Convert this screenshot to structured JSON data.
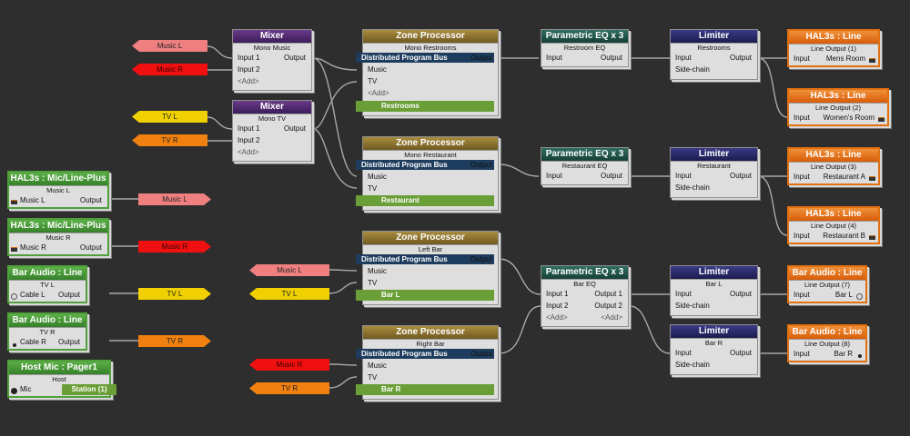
{
  "colors": {
    "canvas": "#2e2e2e",
    "mixer": "#4a2a6a",
    "zone_processor": "#8a733a",
    "parametric_eq": "#1f5247",
    "limiter": "#2a2a6a",
    "output": "#e8701c",
    "input_block": "#4f9f3b",
    "program_bus": "#1e3d5e",
    "zone_bar": "#6a9e36",
    "music_l": "#f08080",
    "music_r": "#f01010",
    "tv_l": "#f0d000",
    "tv_r": "#f08010"
  },
  "mixers": [
    {
      "title": "Mixer",
      "name": "Mono Music",
      "in1": "Input 1",
      "in2": "Input 2",
      "add": "<Add>",
      "out": "Output"
    },
    {
      "title": "Mixer",
      "name": "Mono TV",
      "in1": "Input 1",
      "in2": "Input 2",
      "add": "<Add>",
      "out": "Output"
    }
  ],
  "zones": [
    {
      "title": "Zone Processor",
      "name": "Mono Restrooms",
      "bus": "Distributed Program Bus",
      "music": "Music",
      "tv": "TV",
      "add": "<Add>",
      "zone": "Restrooms",
      "out": "Output"
    },
    {
      "title": "Zone Processor",
      "name": "Mono Restaurant",
      "bus": "Distributed Program Bus",
      "music": "Music",
      "tv": "TV",
      "zone": "Restaurant",
      "out": "Output"
    },
    {
      "title": "Zone Processor",
      "name": "Left Bar",
      "bus": "Distributed Program Bus",
      "music": "Music",
      "tv": "TV",
      "zone": "Bar L",
      "out": "Output"
    },
    {
      "title": "Zone Processor",
      "name": "Right Bar",
      "bus": "Distributed Program Bus",
      "music": "Music",
      "tv": "TV",
      "zone": "Bar R",
      "out": "Output"
    }
  ],
  "eqs": [
    {
      "title": "Parametric EQ x 3",
      "name": "Restroom EQ",
      "in": "Input",
      "out": "Output"
    },
    {
      "title": "Parametric EQ x 3",
      "name": "Restaurant EQ",
      "in": "Input",
      "out": "Output"
    },
    {
      "title": "Parametric EQ x 3",
      "name": "Bar EQ",
      "in1": "Input 1",
      "in2": "Input 2",
      "out1": "Output 1",
      "out2": "Output 2",
      "add_in": "<Add>",
      "add_out": "<Add>"
    }
  ],
  "limiters": [
    {
      "title": "Limiter",
      "name": "Restrooms",
      "in": "Input",
      "sc": "Side-chain",
      "out": "Output"
    },
    {
      "title": "Limiter",
      "name": "Restaurant",
      "in": "Input",
      "sc": "Side-chain",
      "out": "Output"
    },
    {
      "title": "Limiter",
      "name": "Bar L",
      "in": "Input",
      "sc": "Side-chain",
      "out": "Output"
    },
    {
      "title": "Limiter",
      "name": "Bar R",
      "in": "Input",
      "sc": "Side-chain",
      "out": "Output"
    }
  ],
  "outputs": [
    {
      "title": "HAL3s : Line",
      "name": "Line Output (1)",
      "in": "Input",
      "dest": "Mens Room"
    },
    {
      "title": "HAL3s : Line",
      "name": "Line Output (2)",
      "in": "Input",
      "dest": "Women's Room"
    },
    {
      "title": "HAL3s : Line",
      "name": "Line Output (3)",
      "in": "Input",
      "dest": "Restaurant A"
    },
    {
      "title": "HAL3s : Line",
      "name": "Line Output (4)",
      "in": "Input",
      "dest": "Restaurant B"
    },
    {
      "title": "Bar Audio : Line",
      "name": "Line Output (7)",
      "in": "Input",
      "dest": "Bar L"
    },
    {
      "title": "Bar Audio : Line",
      "name": "Line Output (8)",
      "in": "Input",
      "dest": "Bar R"
    }
  ],
  "sources": [
    {
      "title": "HAL3s : Mic/Line-Plus",
      "name": "Music L",
      "src": "Music L",
      "out": "Output"
    },
    {
      "title": "HAL3s : Mic/Line-Plus",
      "name": "Music R",
      "src": "Music R",
      "out": "Output"
    },
    {
      "title": "Bar Audio : Line",
      "name": "TV L",
      "src": "Cable L",
      "out": "Output"
    },
    {
      "title": "Bar Audio : Line",
      "name": "TV R",
      "src": "Cable R",
      "out": "Output"
    }
  ],
  "host": {
    "title": "Host Mic : Pager1",
    "name": "Host",
    "src": "Mic",
    "station": "Station (1)"
  },
  "tags": {
    "music_l": "Music L",
    "music_r": "Music R",
    "tv_l": "TV L",
    "tv_r": "TV R"
  }
}
